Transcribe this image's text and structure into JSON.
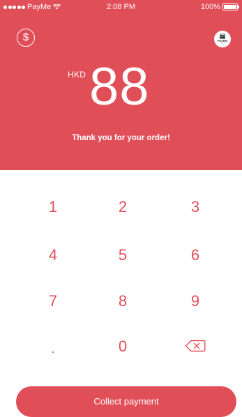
{
  "status_bar": {
    "carrier": "PayMe",
    "time": "2:08 PM",
    "battery": "100%"
  },
  "header": {
    "currency": "HKD",
    "amount": "88",
    "message": "Thank you for your order!",
    "logo_text": "PayMe",
    "dollar_icon": "$",
    "accent_color": "#e04e58"
  },
  "keypad": {
    "keys": [
      "1",
      "2",
      "3",
      "4",
      "5",
      "6",
      "7",
      "8",
      "9",
      ".",
      "0"
    ],
    "backspace_icon": "backspace-icon"
  },
  "actions": {
    "collect_label": "Collect payment"
  }
}
